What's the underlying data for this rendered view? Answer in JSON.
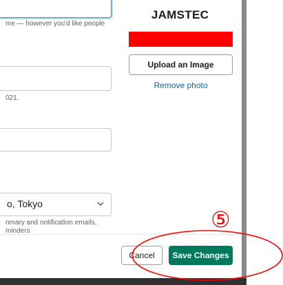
{
  "form": {
    "top_hint": "me — however you'd like people",
    "mid_hint": "021.",
    "timezone": {
      "selected": "o, Tokyo",
      "hint_line1": "nmary and notification emails,",
      "hint_line2": "minders"
    }
  },
  "org": {
    "name": "JAMSTEC",
    "brand_color": "#ff0000"
  },
  "photo": {
    "upload_label": "Upload an Image",
    "remove_label": "Remove photo"
  },
  "footer": {
    "cancel_label": "Cancel",
    "save_label": "Save Changes"
  },
  "annotation": {
    "step_marker": "⑤",
    "color": "#ff0000"
  },
  "colors": {
    "primary_button": "#007a5a",
    "link": "#1264a3",
    "focus_ring": "#1d9bd1"
  }
}
